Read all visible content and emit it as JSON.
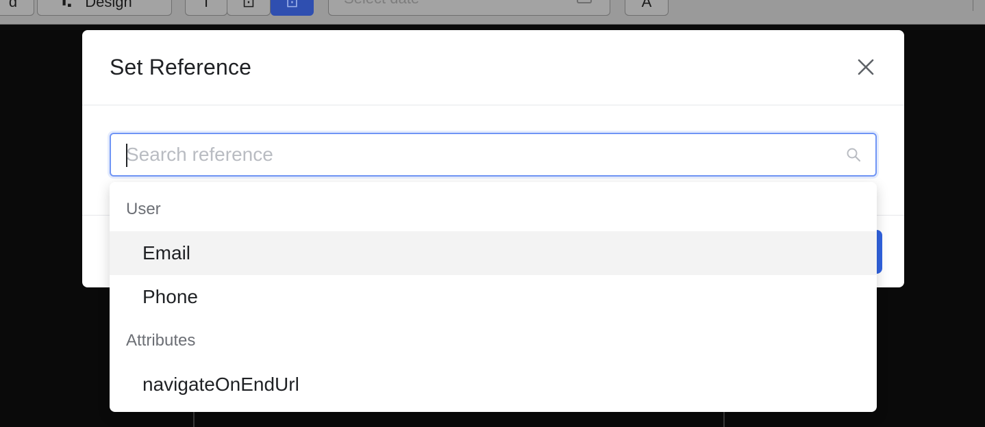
{
  "toolbar": {
    "partial_label": "d",
    "design_label": "Design",
    "date_placeholder": "Select date",
    "font_label": "A"
  },
  "modal": {
    "title": "Set Reference",
    "close_icon": "close-icon"
  },
  "search": {
    "placeholder": "Search reference",
    "value": "",
    "icon": "search-icon"
  },
  "dropdown": {
    "groups": [
      {
        "label": "User",
        "options": [
          "Email",
          "Phone"
        ]
      },
      {
        "label": "Attributes",
        "options": [
          "navigateOnEndUrl"
        ]
      }
    ],
    "hovered_option": "Email"
  },
  "colors": {
    "overlay": "#0a0a0a",
    "focus_border": "#6f94f5",
    "primary": "#3163e0",
    "hover_bg": "#f3f3f3"
  }
}
